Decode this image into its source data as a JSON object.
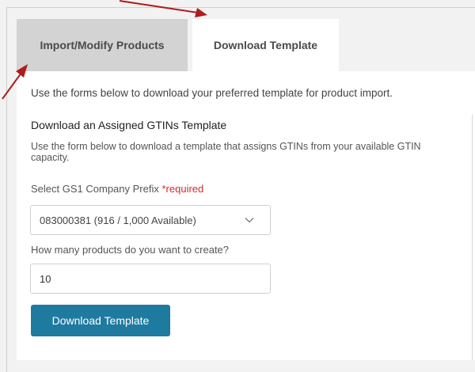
{
  "tabs": [
    {
      "label": "Import/Modify Products",
      "active": false
    },
    {
      "label": "Download Template",
      "active": true
    }
  ],
  "intro": "Use the forms below to download your preferred template for product import.",
  "section": {
    "title": "Download an Assigned GTINs Template",
    "description": "Use the form below to download a template that assigns GTINs from your available GTIN capacity."
  },
  "prefix": {
    "label": "Select GS1 Company Prefix",
    "required": "*required",
    "selected": "083000381 (916 / 1,000 Available)"
  },
  "quantity": {
    "label": "How many products do you want to create?",
    "value": "10"
  },
  "download_button": "Download Template",
  "colors": {
    "accent_button": "#1f7aa0",
    "annotation_arrow": "#b01c1c",
    "required": "#d12c2c",
    "inactive_tab": "#d3d3d3"
  }
}
